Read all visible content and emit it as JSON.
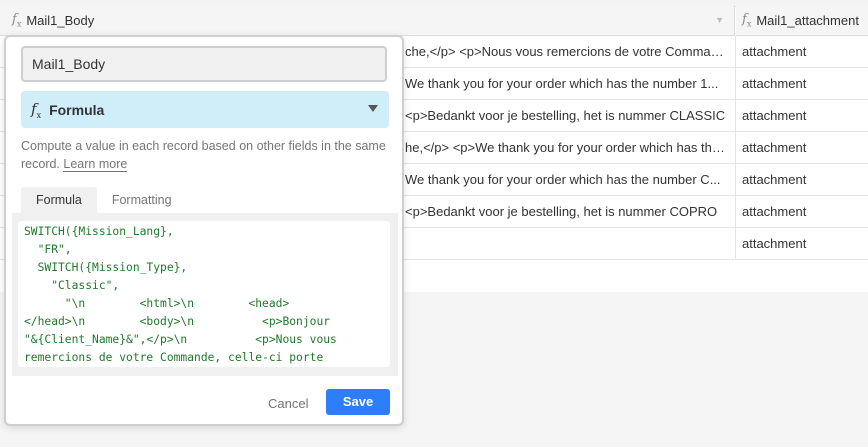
{
  "grid": {
    "columns": [
      {
        "name": "Mail1_Body",
        "type_icon": "formula-icon"
      },
      {
        "name": "Mail1_attachment",
        "type_icon": "formula-icon"
      }
    ],
    "rows": [
      {
        "body": "che,</p> <p>Nous vous remercions de votre Commande, celle-ci porte",
        "attachment": "attachment"
      },
      {
        "body": "We thank you for your order which has the number 1...",
        "attachment": "attachment"
      },
      {
        "body": "<p>Bedankt voor je bestelling, het is nummer CLASSIC",
        "attachment": "attachment"
      },
      {
        "body": "he,</p> <p>We thank you for your order which has the number",
        "attachment": "attachment"
      },
      {
        "body": "We thank you for your order which has the number C...",
        "attachment": "attachment"
      },
      {
        "body": "<p>Bedankt voor je bestelling, het is nummer COPRO",
        "attachment": "attachment"
      },
      {
        "body": "",
        "attachment": "attachment"
      }
    ]
  },
  "field_editor": {
    "field_name": "Mail1_Body",
    "field_type": "Formula",
    "description": "Compute a value in each record based on other fields in the same record.",
    "learn_more": "Learn more",
    "tabs": [
      "Formula",
      "Formatting"
    ],
    "active_tab": "Formula",
    "formula_code": "SWITCH({Mission_Lang},\n  \"FR\",\n  SWITCH({Mission_Type},\n    \"Classic\",\n      \"\\n        <html>\\n        <head>\n</head>\\n        <body>\\n          <p>Bonjour\n\"&{Client_Name}&\",</p>\\n          <p>Nous vous\nremercions de votre Commande, celle-ci porte",
    "cancel_label": "Cancel",
    "save_label": "Save",
    "accent_color": "#2d7ff9",
    "type_bg_color": "#cfeefa"
  }
}
